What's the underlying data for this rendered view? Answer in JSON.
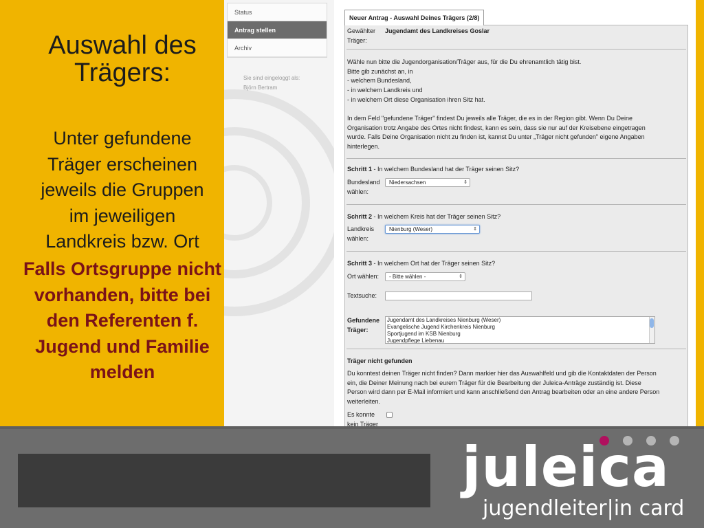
{
  "slide": {
    "title_line1": "Auswahl des",
    "title_line2": "Trägers:",
    "body_lines": [
      "Unter gefundene",
      "Träger erscheinen",
      "jeweils die Gruppen",
      "im jeweiligen",
      "Landkreis bzw. Ort"
    ],
    "note_lines": [
      "Falls Ortsgruppe nicht",
      "vorhanden, bitte bei",
      "den Referenten f.",
      "Jugend und Familie",
      "melden"
    ]
  },
  "nav": {
    "items": [
      {
        "label": "Status"
      },
      {
        "label": "Antrag stellen"
      },
      {
        "label": "Archiv"
      }
    ],
    "logged_in_label": "Sie sind eingeloggt als:",
    "user_name": "Björn Bertram"
  },
  "form": {
    "tab_title": "Neuer Antrag - Auswahl Deines Trägers (2/8)",
    "selected_label_1": "Gewählter",
    "selected_label_2": "Träger:",
    "selected_value": "Jugendamt des Landkreises Goslar",
    "intro_lines": [
      "Wähle nun bitte die Jugendorganisation/Träger aus, für die Du ehrenamtlich tätig bist.",
      "Bitte gib zunächst an, in",
      "- welchem Bundesland,",
      "- in welchem Landkreis und",
      "- in welchem Ort diese Organisation ihren Sitz hat."
    ],
    "info_lines": [
      "In dem Feld \"gefundene Träger\" findest Du jeweils alle Träger, die es in der Region gibt. Wenn Du Deine",
      "Organisation trotz Angabe des Ortes nicht findest, kann es sein, dass sie nur auf der Kreisebene eingetragen",
      "wurde. Falls Deine Organisation nicht zu finden ist, kannst Du unter „Träger nicht gefunden\" eigene Angaben",
      "hinterlegen."
    ],
    "step1_bold": "Schritt 1",
    "step1_text": " - In welchem Bundesland hat der Träger seinen Sitz?",
    "step1_label_1": "Bundesland",
    "step1_label_2": "wählen:",
    "step1_value": "Niedersachsen",
    "step2_bold": "Schritt 2",
    "step2_text": " - In welchem Kreis hat der Träger seinen Sitz?",
    "step2_label_1": "Landkreis",
    "step2_label_2": "wählen:",
    "step2_value": "Nienburg (Weser)",
    "step3_bold": "Schritt 3",
    "step3_text": " - In welchem Ort hat der Träger seinen Sitz?",
    "step3_label": "Ort wählen:",
    "step3_value": "- Bitte wählen -",
    "search_label": "Textsuche:",
    "search_value": "",
    "found_label_1": "Gefundene",
    "found_label_2": "Träger:",
    "found_items": [
      "Jugendamt des Landkreises Nienburg (Weser)",
      "Evangelische Jugend Kirchenkreis Nienburg",
      "Sportjugend im KSB Nienburg",
      "Jugendpflege Liebenau"
    ],
    "not_found_title": "Träger nicht gefunden",
    "not_found_lines": [
      "Du konntest deinen Träger nicht finden? Dann markier hier das Auswahlfeld und gib die Kontaktdaten der Person",
      "ein, die Deiner Meinung nach bei eurem Träger für die Bearbeitung der Juleica-Anträge zuständig ist. Diese",
      "Person wird dann per E-Mail informiert und kann anschließend den Antrag bearbeiten oder an eine andere Person",
      "weiterleiten."
    ],
    "checkbox_label_1": "Es konnte",
    "checkbox_label_2": "kein Träger"
  },
  "logo": {
    "main": "juleica",
    "sub": "jugendleiter|in card"
  },
  "colors": {
    "slide_yellow": "#f0b400",
    "note_red": "#7a1218",
    "logo_accent": "#b0105e",
    "logo_dot_grey": "#b5b5b5",
    "bar_grey": "#6d6d6d"
  }
}
